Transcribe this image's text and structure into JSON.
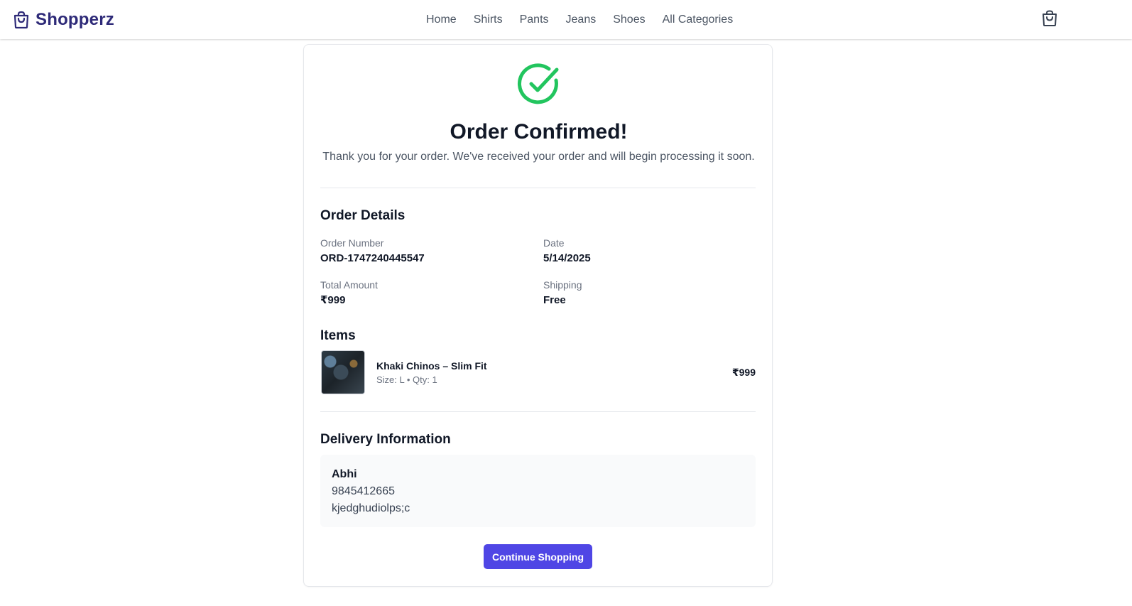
{
  "header": {
    "brand_name": "Shopperz",
    "brand_icon": "shopping-bag-icon",
    "nav": [
      {
        "label": "Home"
      },
      {
        "label": "Shirts"
      },
      {
        "label": "Pants"
      },
      {
        "label": "Jeans"
      },
      {
        "label": "Shoes"
      },
      {
        "label": "All Categories"
      }
    ],
    "cart_icon": "shopping-bag-icon"
  },
  "confirmation": {
    "icon": "check-circle-icon",
    "title": "Order Confirmed!",
    "message": "Thank you for your order. We've received your order and will begin processing it soon."
  },
  "order_details": {
    "heading": "Order Details",
    "order_number_label": "Order Number",
    "order_number": "ORD-1747240445547",
    "date_label": "Date",
    "date": "5/14/2025",
    "total_label": "Total Amount",
    "total": "₹999",
    "shipping_label": "Shipping",
    "shipping": "Free"
  },
  "items": {
    "heading": "Items",
    "list": [
      {
        "name": "Khaki Chinos – Slim Fit",
        "meta": "Size: L • Qty: 1",
        "price": "₹999"
      }
    ]
  },
  "delivery": {
    "heading": "Delivery Information",
    "name": "Abhi",
    "phone": "9845412665",
    "address": "kjedghudiolps;c"
  },
  "actions": {
    "continue_label": "Continue Shopping"
  },
  "colors": {
    "brand": "#2e2a78",
    "accent": "#4f46e5",
    "success": "#22c55e"
  }
}
